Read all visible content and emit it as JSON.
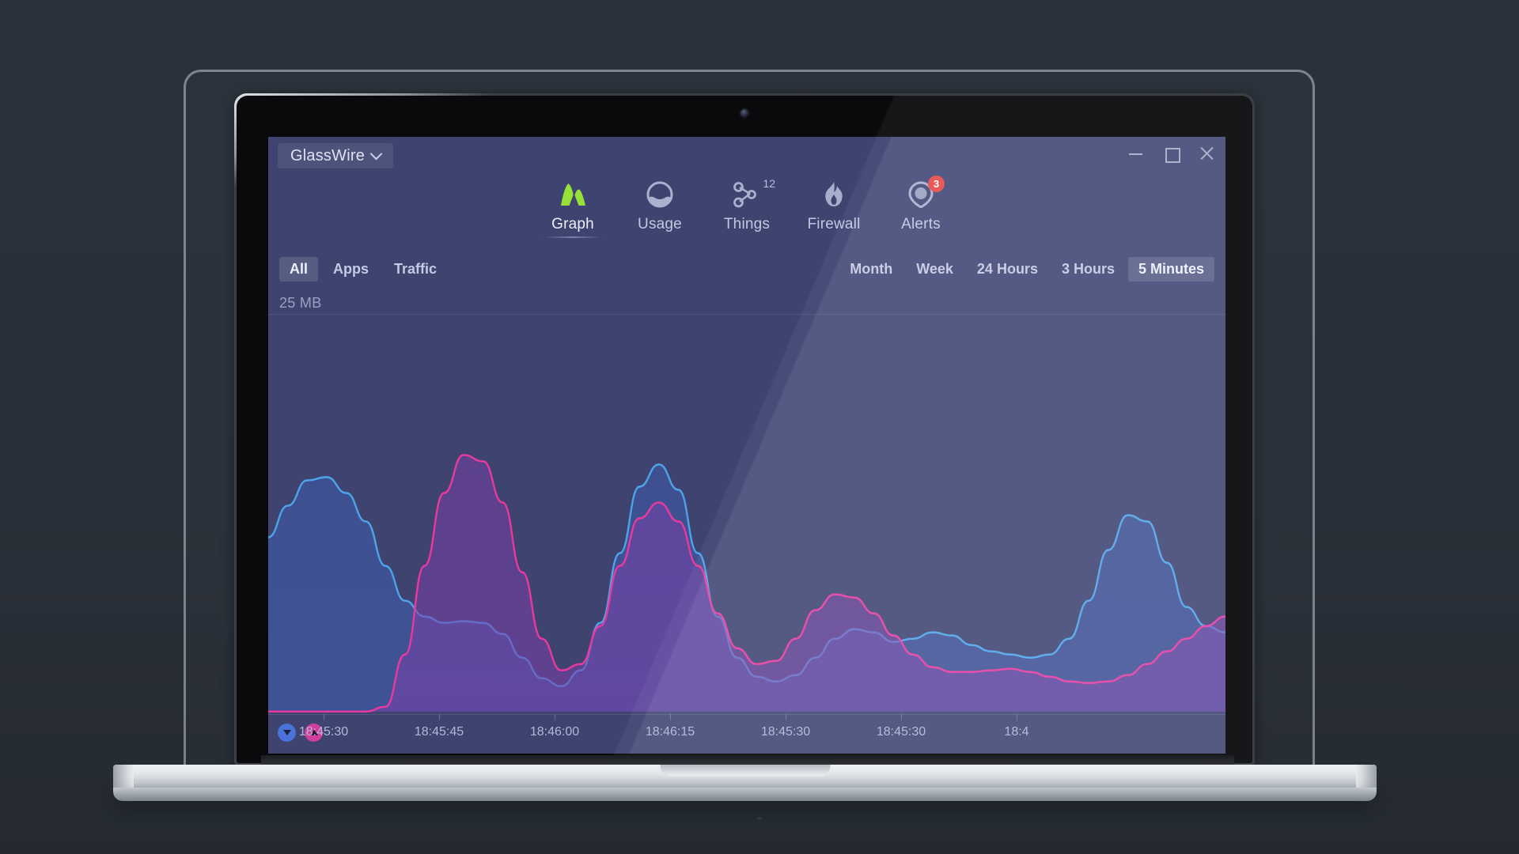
{
  "window": {
    "app_menu_label": "GlassWire",
    "app_menu_icon": "chevron-down-icon",
    "controls": {
      "minimize": "minimize-icon",
      "maximize": "maximize-icon",
      "close": "close-icon"
    }
  },
  "nav": {
    "items": [
      {
        "label": "Graph",
        "icon": "mountain-graph-icon",
        "active": true,
        "badge": null,
        "superscript": null
      },
      {
        "label": "Usage",
        "icon": "usage-pie-icon",
        "active": false,
        "badge": null,
        "superscript": null
      },
      {
        "label": "Things",
        "icon": "network-nodes-icon",
        "active": false,
        "badge": null,
        "superscript": "12"
      },
      {
        "label": "Firewall",
        "icon": "flame-icon",
        "active": false,
        "badge": null,
        "superscript": null
      },
      {
        "label": "Alerts",
        "icon": "shield-alert-icon",
        "active": false,
        "badge": "3",
        "superscript": null
      }
    ]
  },
  "filters": {
    "left": [
      {
        "label": "All",
        "active": true
      },
      {
        "label": "Apps",
        "active": false
      },
      {
        "label": "Traffic",
        "active": false
      }
    ],
    "right": [
      {
        "label": "Month",
        "active": false
      },
      {
        "label": "Week",
        "active": false
      },
      {
        "label": "24 Hours",
        "active": false
      },
      {
        "label": "3 Hours",
        "active": false
      },
      {
        "label": "5 Minutes",
        "active": true
      }
    ]
  },
  "chart_data": {
    "type": "area",
    "title": "",
    "xlabel": "",
    "ylabel": "25 MB",
    "y_axis_top_label": "25 MB",
    "ylim": [
      0,
      25
    ],
    "y_unit": "MB",
    "grid": true,
    "legend_position": "bottom-left",
    "x_tick_labels": [
      "18:45:30",
      "18:45:45",
      "18:46:00",
      "18:46:15",
      "18:45:30",
      "18:45:30",
      "18:4"
    ],
    "series": [
      {
        "name": "Download",
        "icon": "download-arrow-icon",
        "color": "#4da3e8",
        "fill_color": "#3f5aa8",
        "values": [
          11.0,
          13.0,
          14.6,
          14.8,
          13.8,
          12.0,
          9.2,
          7.0,
          6.0,
          5.6,
          5.7,
          5.6,
          4.9,
          3.4,
          2.1,
          1.6,
          2.6,
          5.6,
          10.0,
          14.2,
          15.6,
          14.0,
          10.0,
          6.0,
          3.4,
          2.2,
          1.9,
          2.3,
          3.4,
          4.6,
          5.2,
          5.0,
          4.4,
          4.6,
          5.0,
          4.8,
          4.2,
          3.8,
          3.6,
          3.4,
          3.6,
          4.6,
          7.0,
          10.2,
          12.4,
          12.0,
          9.4,
          6.6,
          5.4,
          5.0
        ]
      },
      {
        "name": "Upload",
        "icon": "upload-arrow-icon",
        "color": "#e8399e",
        "fill_color": "#7b3fa8",
        "values": [
          0.0,
          0.0,
          0.0,
          0.0,
          0.0,
          0.0,
          0.3,
          3.6,
          9.2,
          13.8,
          16.2,
          15.8,
          13.2,
          8.8,
          4.6,
          2.6,
          3.0,
          5.4,
          9.2,
          12.2,
          13.2,
          12.0,
          9.2,
          6.2,
          4.0,
          3.0,
          3.2,
          4.6,
          6.4,
          7.4,
          7.2,
          6.2,
          4.8,
          3.6,
          2.8,
          2.5,
          2.5,
          2.6,
          2.7,
          2.5,
          2.2,
          1.9,
          1.8,
          1.9,
          2.3,
          3.0,
          3.8,
          4.6,
          5.4,
          6.0
        ]
      }
    ]
  }
}
